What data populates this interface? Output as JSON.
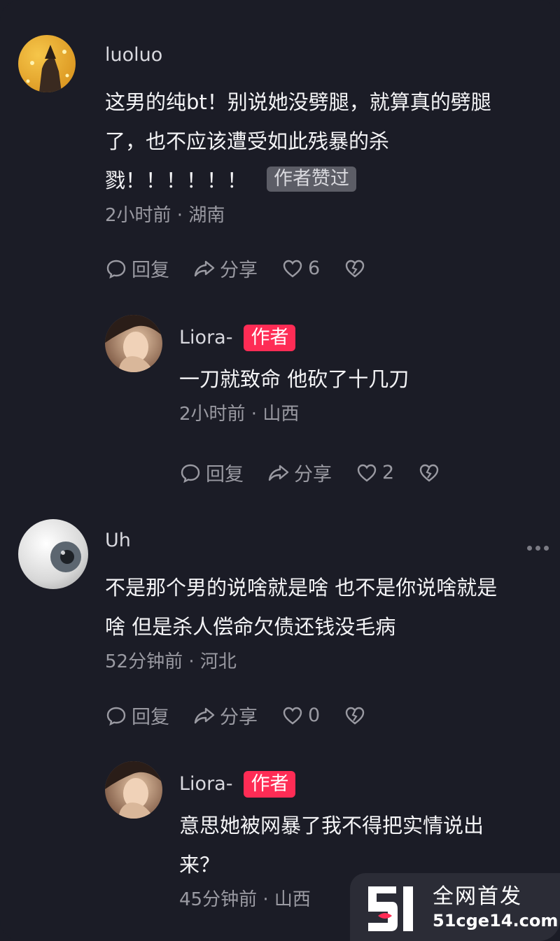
{
  "comments": [
    {
      "username": "luoluo",
      "text_lines": [
        "这男的纯bt！别说她没劈腿，就算真的劈腿",
        "了，也不应该遭受如此残暴的杀",
        "戮！！！！！！"
      ],
      "liked_tag": "作者赞过",
      "meta": "2小时前 · 湖南",
      "reply_label": "回复",
      "share_label": "分享",
      "like_count": "6"
    },
    {
      "username": "Liora-",
      "author_tag": "作者",
      "text_lines": [
        "一刀就致命 他砍了十几刀"
      ],
      "meta": "2小时前 · 山西",
      "reply_label": "回复",
      "share_label": "分享",
      "like_count": "2"
    },
    {
      "username": "Uh",
      "text_lines": [
        "不是那个男的说啥就是啥 也不是你说啥就是",
        "啥 但是杀人偿命欠债还钱没毛病"
      ],
      "meta": "52分钟前 · 河北",
      "reply_label": "回复",
      "share_label": "分享",
      "like_count": "0"
    },
    {
      "username": "Liora-",
      "author_tag": "作者",
      "text_lines": [
        "意思她被网暴了我不得把实情说出",
        "来？"
      ],
      "meta": "45分钟前 · 山西"
    }
  ],
  "watermark": {
    "title": "全网首发",
    "url": "51cge14.com"
  },
  "colors": {
    "background": "#1b1c26",
    "author_tag": "#fe2c55",
    "meta_text": "#9a9aa2"
  },
  "icons": [
    "reply-icon",
    "share-icon",
    "heart-icon",
    "broken-heart-icon",
    "more-icon"
  ]
}
